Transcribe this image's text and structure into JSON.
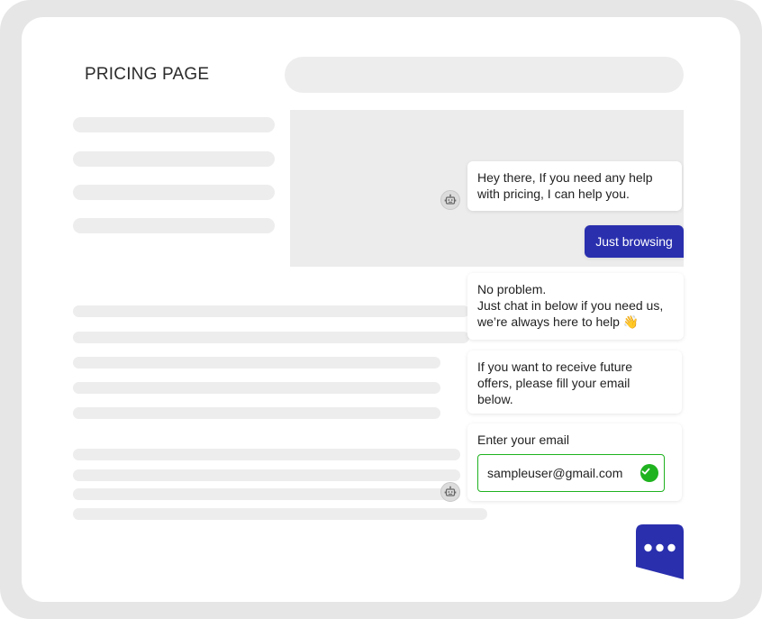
{
  "page": {
    "title": "PRICING PAGE"
  },
  "chat": {
    "greeting": {
      "line1": "Hey there, If you need any help",
      "line2": "with pricing, I can help you."
    },
    "user_reply": "Just browsing",
    "response": {
      "line1": "No problem.",
      "line2": "Just chat in below if you need us,",
      "line3": "we’re always here to help 👋"
    },
    "offer": {
      "line1": "If you want to receive future",
      "line2": "offers, please fill your email",
      "line3": "below."
    },
    "email_form": {
      "label": "Enter your email",
      "value": "sampleuser@gmail.com"
    }
  },
  "colors": {
    "accent": "#2a2fae",
    "success": "#1fb31f",
    "placeholder": "#ededed",
    "frame": "#e6e6e6"
  },
  "icons": {
    "bot_avatar": "robot-icon",
    "valid": "check-icon",
    "launcher": "chat-bubble-dots-icon"
  }
}
